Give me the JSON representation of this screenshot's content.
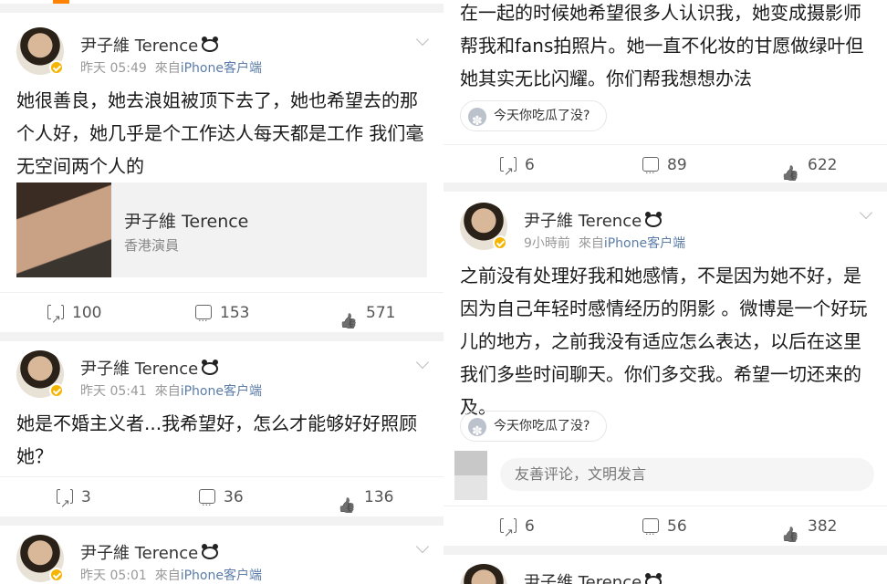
{
  "left": {
    "post1": {
      "name": "尹子維 Terence",
      "time": "昨天 05:49",
      "from": "來自",
      "source": "iPhone客户端",
      "text": "她很善良，她去浪姐被顶下去了，她也希望去的那个人好，她几乎是个工作达人每天都是工作 我们毫无空间两个人的",
      "card": {
        "name": "尹子維 Terence",
        "desc": "香港演員"
      },
      "share": "100",
      "comments": "153",
      "likes": "571"
    },
    "post2": {
      "name": "尹子維 Terence",
      "time": "昨天 05:41",
      "from": "來自",
      "source": "iPhone客户端",
      "text": "她是不婚主义者...我希望好，怎么才能够好好照顾她？",
      "share": "3",
      "comments": "36",
      "likes": "136"
    },
    "post3": {
      "name": "尹子維 Terence",
      "time": "昨天 05:01",
      "from": "來自",
      "source": "iPhone客户端"
    }
  },
  "right": {
    "post1": {
      "text": "在一起的时候她希望很多人认识我，她变成摄影师帮我和fans拍照片。她一直不化妆的甘愿做绿叶但她其实无比闪耀。你们帮我想想办法",
      "topic": "今天你吃瓜了没?",
      "share": "6",
      "comments": "89",
      "likes": "622"
    },
    "post2": {
      "name": "尹子維 Terence",
      "time": "9小時前",
      "from": "來自",
      "source": "iPhone客户端",
      "text": "之前没有处理好我和她感情，不是因为她不好，是因为自己年轻时感情经历的阴影 。微博是一个好玩儿的地方，之前我没有适应怎么表达，以后在这里我们多些时间聊天。你们多交我。希望一切还来的及。",
      "topic": "今天你吃瓜了没?",
      "comment_placeholder": "友善评论，文明发言",
      "share": "6",
      "comments": "56",
      "likes": "382"
    },
    "post3": {
      "name": "尹子維 Terence"
    }
  },
  "colors": {
    "accent": "#ff8200",
    "link": "#5b7da8",
    "verified": "#f4b400"
  }
}
